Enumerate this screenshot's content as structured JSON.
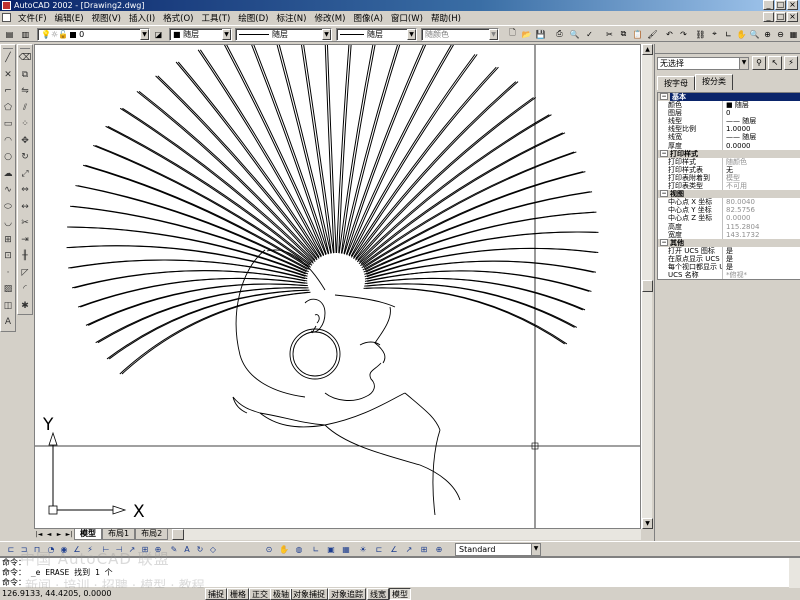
{
  "window": {
    "title": "AutoCAD 2002 - [Drawing2.dwg]",
    "min": "_",
    "max": "□",
    "close": "×"
  },
  "menu": [
    "文件(F)",
    "编辑(E)",
    "视图(V)",
    "插入(I)",
    "格式(O)",
    "工具(T)",
    "绘图(D)",
    "标注(N)",
    "修改(M)",
    "图像(A)",
    "窗口(W)",
    "帮助(H)"
  ],
  "layer_bar": {
    "layer_name": "0",
    "color": "■ 随层",
    "linetype": "随层",
    "lineweight": "随层",
    "plotstyle": "随颜色"
  },
  "drawing": {
    "ucs_y": "Y",
    "ucs_x": "X",
    "background": "#ffffff",
    "line_color": "#000000"
  },
  "tabs": [
    "模型",
    "布局1",
    "布局2"
  ],
  "tab_nav": [
    "|◄",
    "◄",
    "►",
    "►|"
  ],
  "properties": {
    "selection": "无选择",
    "tab_alpha": "按字母",
    "tab_cat": "按分类",
    "cat_basic": "基本",
    "basic": [
      {
        "k": "颜色",
        "v": "■ 随层"
      },
      {
        "k": "图层",
        "v": "0"
      },
      {
        "k": "线型",
        "v": "—— 随层"
      },
      {
        "k": "线型比例",
        "v": "1.0000"
      },
      {
        "k": "线宽",
        "v": "—— 随层"
      },
      {
        "k": "厚度",
        "v": "0.0000"
      }
    ],
    "cat_plot": "打印样式",
    "plot": [
      {
        "k": "打印样式",
        "v": "随颜色",
        "grey": true
      },
      {
        "k": "打印样式表",
        "v": "无"
      },
      {
        "k": "打印表附着到",
        "v": "模型",
        "grey": true
      },
      {
        "k": "打印表类型",
        "v": "不可用",
        "grey": true
      }
    ],
    "cat_view": "视图",
    "view": [
      {
        "k": "中心点 X 坐标",
        "v": "80.0040",
        "grey": true
      },
      {
        "k": "中心点 Y 坐标",
        "v": "82.5756",
        "grey": true
      },
      {
        "k": "中心点 Z 坐标",
        "v": "0.0000",
        "grey": true
      },
      {
        "k": "高度",
        "v": "115.2804",
        "grey": true
      },
      {
        "k": "宽度",
        "v": "143.1732",
        "grey": true
      }
    ],
    "cat_misc": "其他",
    "misc": [
      {
        "k": "打开 UCS 图标",
        "v": "是"
      },
      {
        "k": "在原点显示 UCS 图",
        "v": "是"
      },
      {
        "k": "每个视口都显示 U",
        "v": "是"
      },
      {
        "k": "UCS 名称",
        "v": "*俯视*",
        "grey": true
      }
    ]
  },
  "dim_style": "Standard",
  "command": {
    "line1": "命令：",
    "line2": "命令： _e ERASE 找到 1 个",
    "line3": "命令：",
    "watermark_top": "中国 AutoCAD 联盟",
    "watermark_bottom": "新闻 · 培训 · 招聘 · 模型 · 教程"
  },
  "status": {
    "coords": "126.9133, 44.4205, 0.0000",
    "buttons": [
      "捕捉",
      "栅格",
      "正交",
      "极轴",
      "对象捕捉",
      "对象追踪",
      "线宽",
      "模型"
    ],
    "active": "模型"
  }
}
